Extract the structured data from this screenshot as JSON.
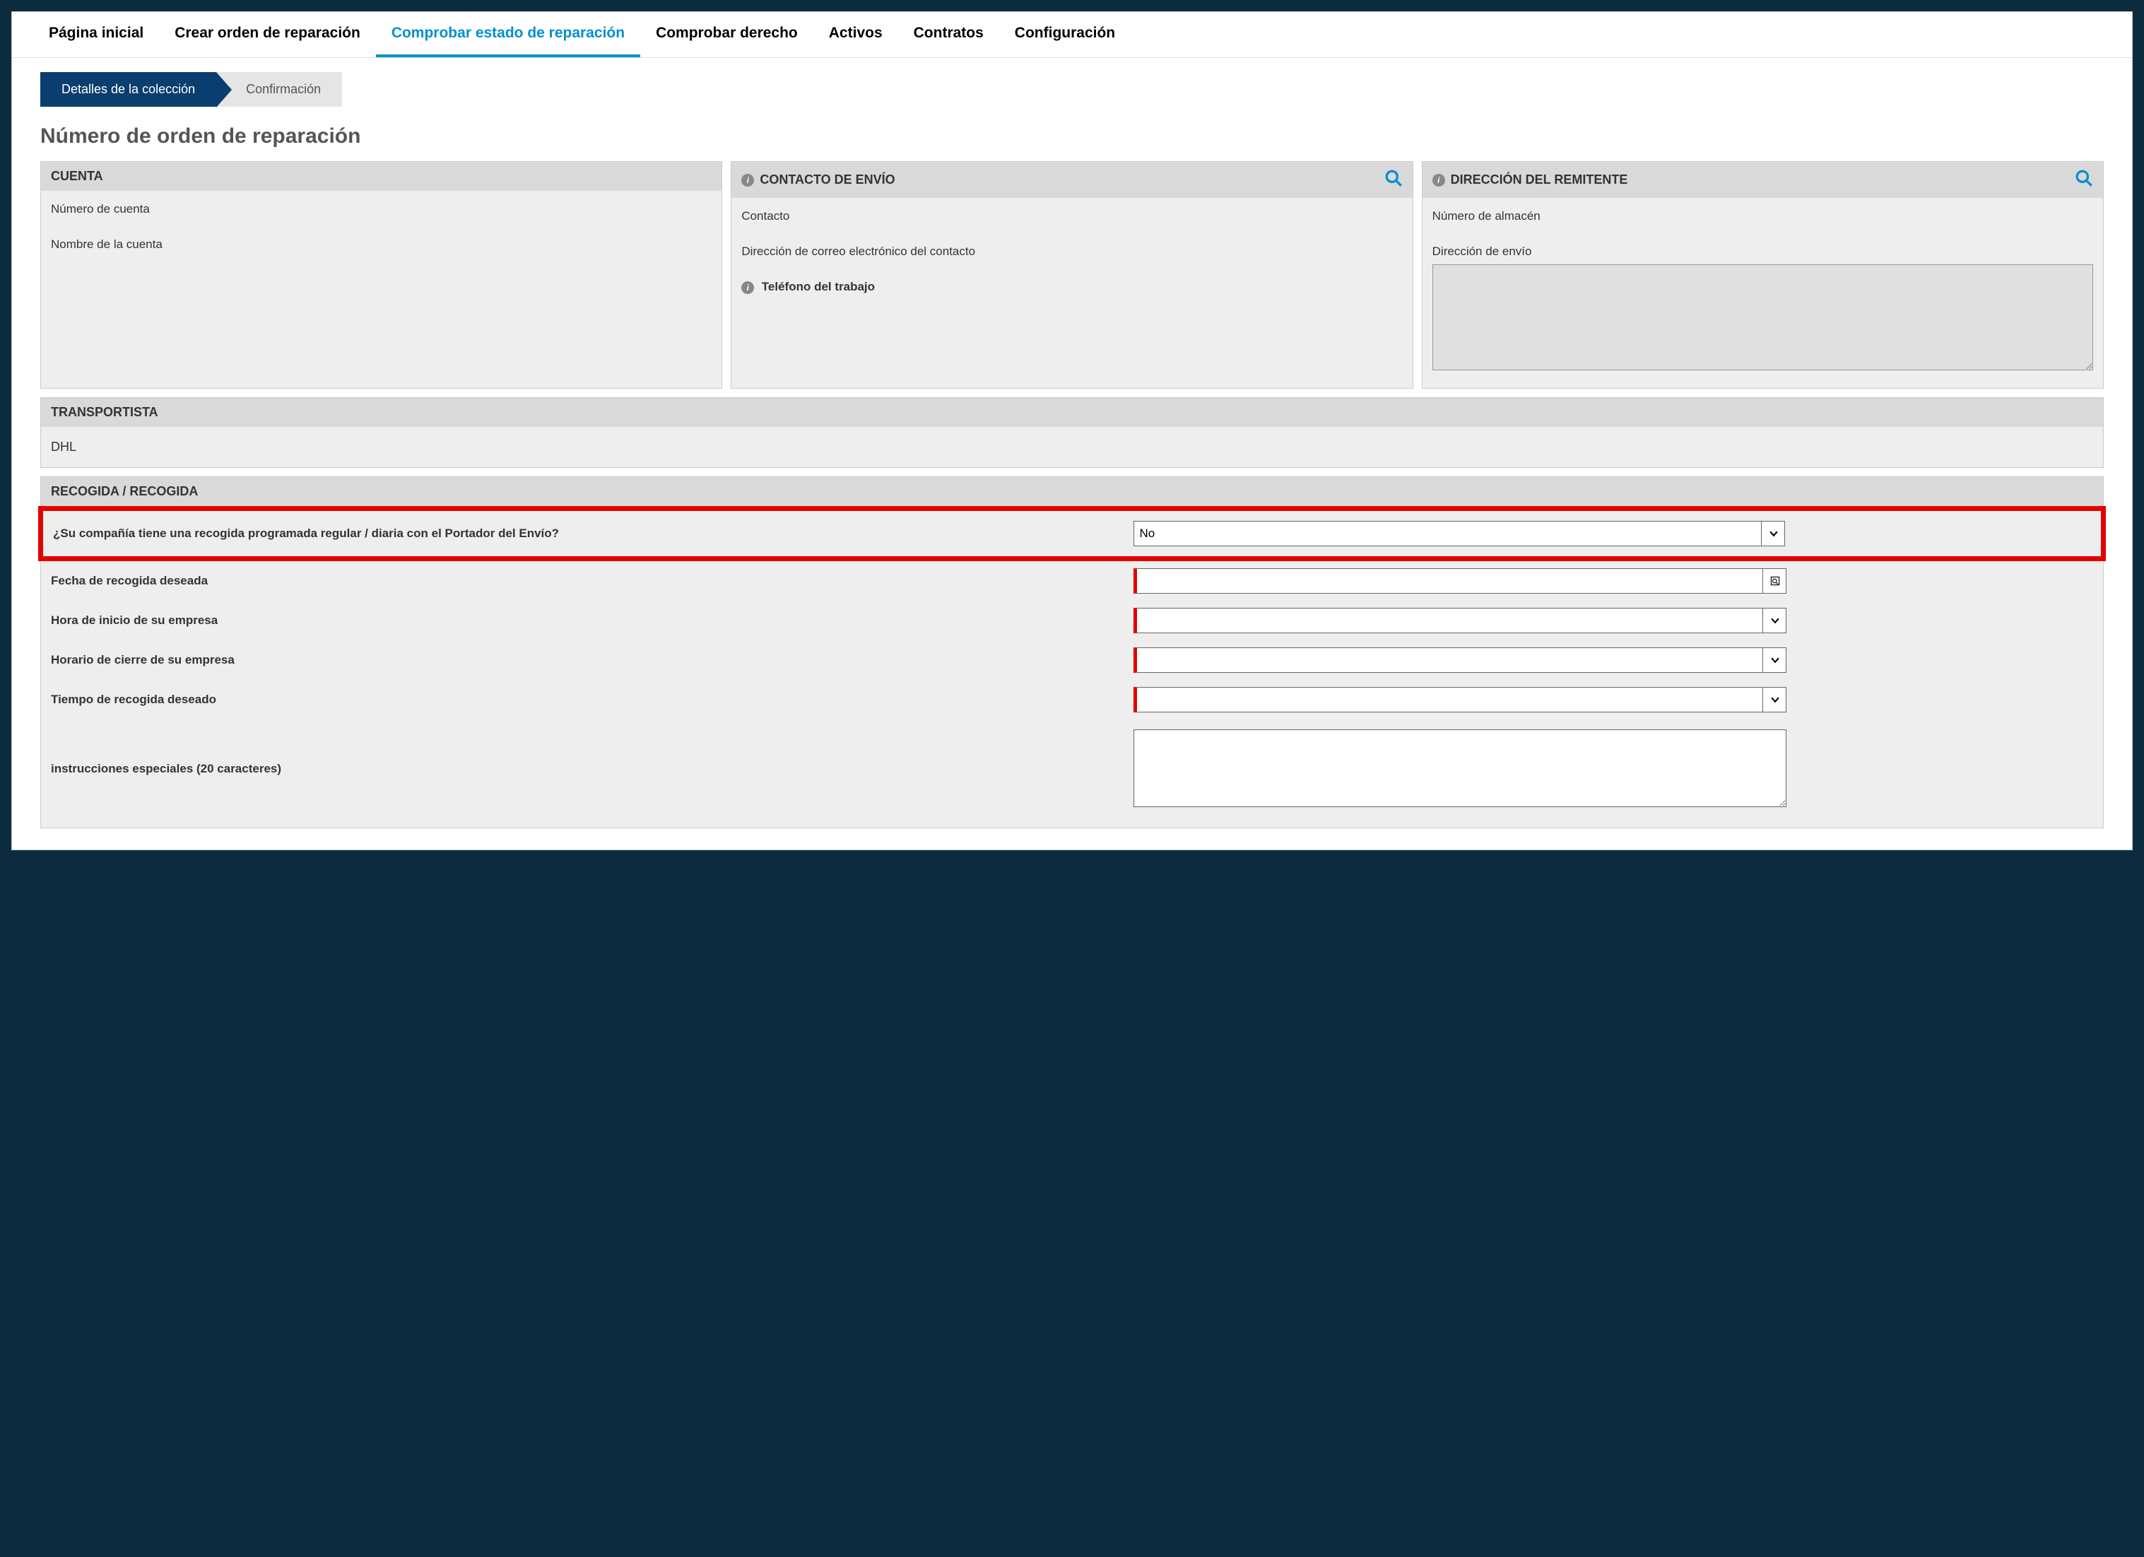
{
  "nav": {
    "tabs": [
      {
        "label": "Página inicial",
        "active": false
      },
      {
        "label": "Crear orden de reparación",
        "active": false
      },
      {
        "label": "Comprobar estado de reparación",
        "active": true
      },
      {
        "label": "Comprobar derecho",
        "active": false
      },
      {
        "label": "Activos",
        "active": false
      },
      {
        "label": "Contratos",
        "active": false
      },
      {
        "label": "Configuración",
        "active": false
      }
    ]
  },
  "wizard": {
    "step_active": "Detalles de la colección",
    "step_next": "Confirmación"
  },
  "page": {
    "title": "Número de orden de reparación"
  },
  "panels": {
    "account": {
      "title": "CUENTA",
      "number_label": "Número de cuenta",
      "name_label": "Nombre de la cuenta"
    },
    "shipping_contact": {
      "title": "CONTACTO DE ENVÍO",
      "contact_label": "Contacto",
      "email_label": "Dirección de correo electrónico del contacto",
      "phone_label": "Teléfono del trabajo"
    },
    "sender_address": {
      "title": "DIRECCIÓN DEL REMITENTE",
      "warehouse_label": "Número de almacén",
      "ship_addr_label": "Dirección de envío",
      "ship_addr_value": ""
    }
  },
  "carrier": {
    "title": "TRANSPORTISTA",
    "value": "DHL"
  },
  "pickup": {
    "title": "RECOGIDA / RECOGIDA",
    "scheduled_q": "¿Su compañía tiene una recogida programada regular / diaria con el Portador del Envío?",
    "scheduled_value": "No",
    "date_label": "Fecha de recogida deseada",
    "date_value": "",
    "open_label": "Hora de inicio de su empresa",
    "open_value": "",
    "close_label": "Horario de cierre de su empresa",
    "close_value": "",
    "pickup_time_label": "Tiempo de recogida deseado",
    "pickup_time_value": "",
    "special_label": "instrucciones especiales (20 caracteres)",
    "special_value": ""
  }
}
